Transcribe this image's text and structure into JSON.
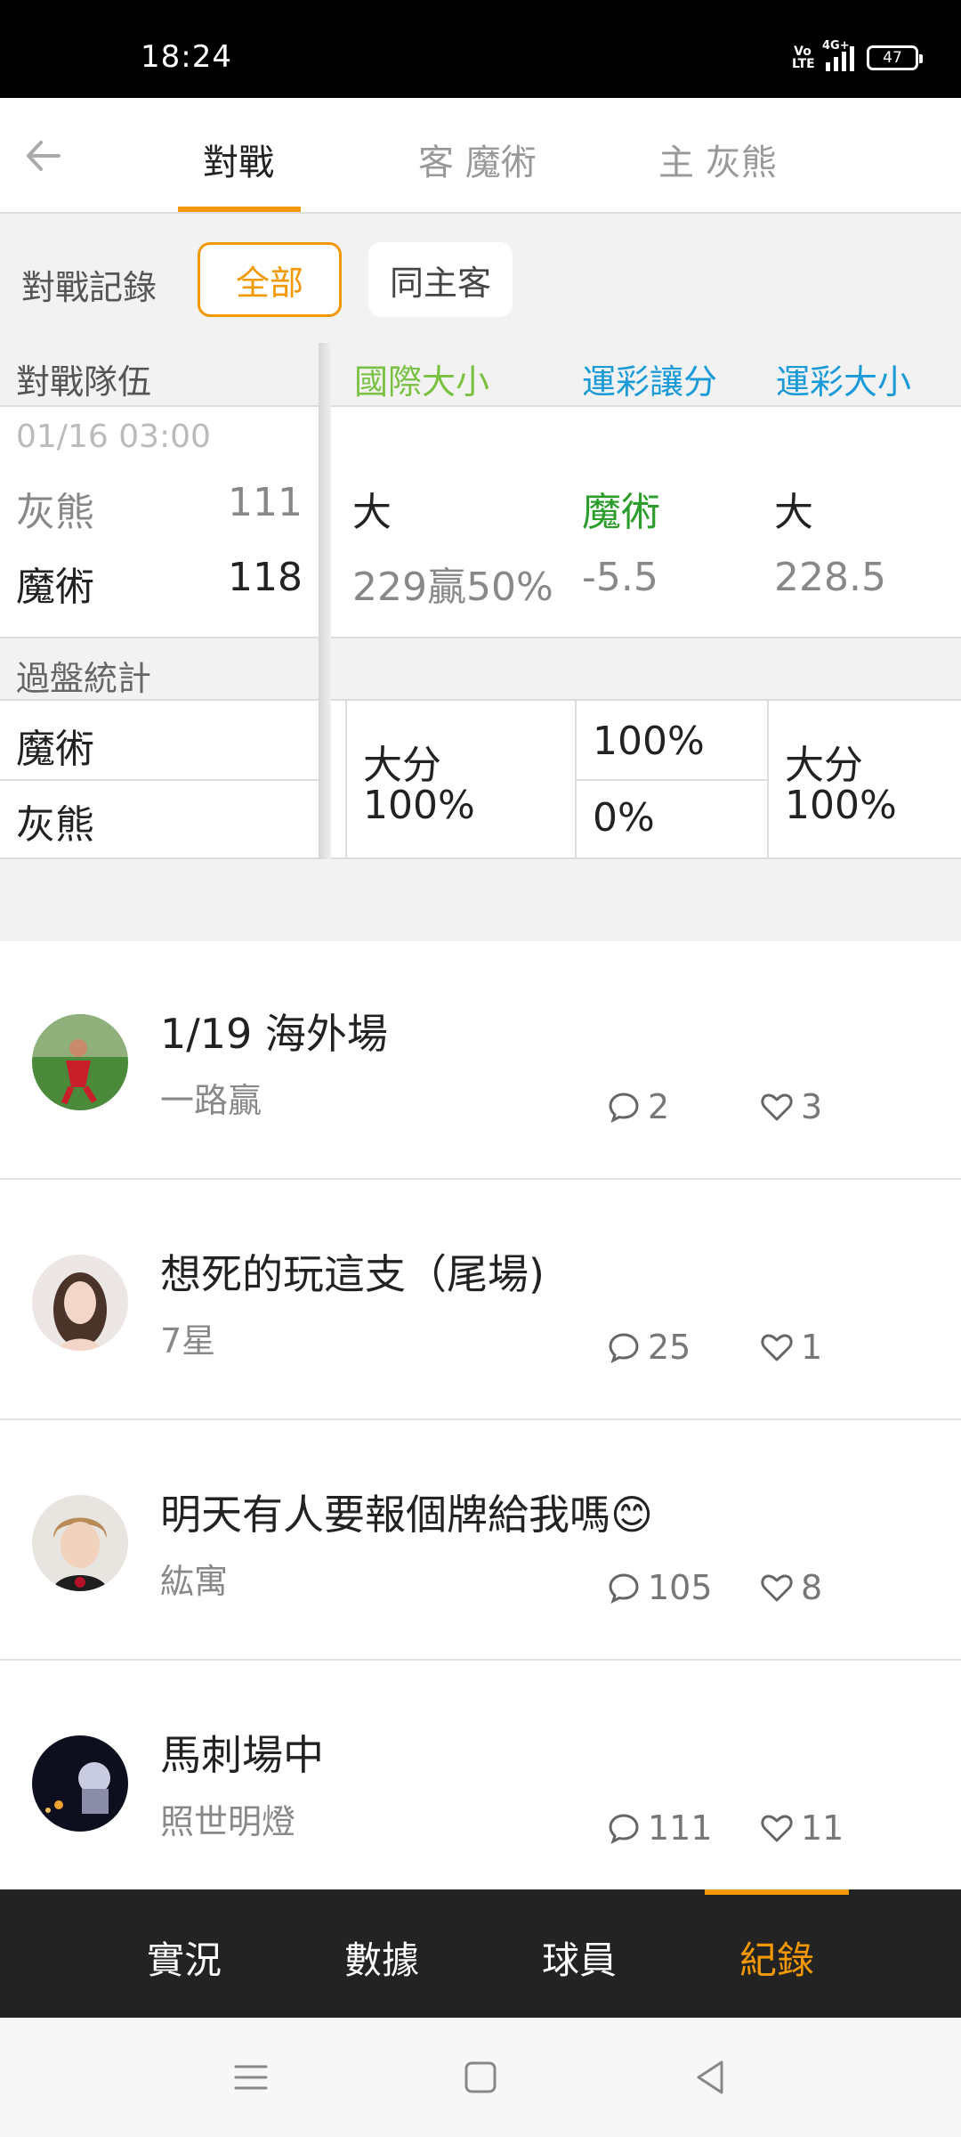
{
  "status_bar": {
    "time": "18:24",
    "volte": "Vo LTE",
    "network": "4G+",
    "battery": "47"
  },
  "header": {
    "tabs": [
      {
        "label": "對戰",
        "active": true
      },
      {
        "label": "客 魔術",
        "active": false
      },
      {
        "label": "主 灰熊",
        "active": false
      }
    ]
  },
  "filter": {
    "label": "對戰記錄",
    "chips": [
      "全部",
      "同主客"
    ],
    "selected": "全部"
  },
  "table": {
    "headers": [
      "對戰隊伍",
      "國際大小",
      "運彩讓分",
      "運彩大小"
    ],
    "match": {
      "date": "01/16 03:00",
      "team1": {
        "name": "灰熊",
        "score": "111"
      },
      "team2": {
        "name": "魔術",
        "score": "118"
      },
      "intl_result": "大",
      "intl_detail": "229贏50%",
      "spread_team": "魔術",
      "spread_value": "-5.5",
      "ou_result": "大",
      "ou_value": "228.5"
    },
    "stats": {
      "label": "過盤統計",
      "team1": "魔術",
      "team2": "灰熊",
      "intl_label": "大分",
      "intl_pct": "100%",
      "spread_team1": "100%",
      "spread_team2": "0%",
      "ou_label": "大分",
      "ou_pct": "100%"
    }
  },
  "posts": [
    {
      "title": "1/19 海外場",
      "author": "一路贏",
      "comments": "2",
      "likes": "3"
    },
    {
      "title": "想死的玩這支（尾場)",
      "author": "7星",
      "comments": "25",
      "likes": "1"
    },
    {
      "title": "明天有人要報個牌給我嗎😊",
      "author": "紘寓",
      "comments": "105",
      "likes": "8"
    },
    {
      "title": "馬刺場中",
      "author": "照世明燈",
      "comments": "111",
      "likes": "11"
    }
  ],
  "bottom_nav": {
    "items": [
      "實況",
      "數據",
      "球員",
      "紀錄"
    ],
    "active": "紀錄"
  },
  "colors": {
    "accent": "#f39800",
    "green_header": "#7ac143",
    "blue_header": "#1a9bd7",
    "bottom_bar": "#232323"
  }
}
